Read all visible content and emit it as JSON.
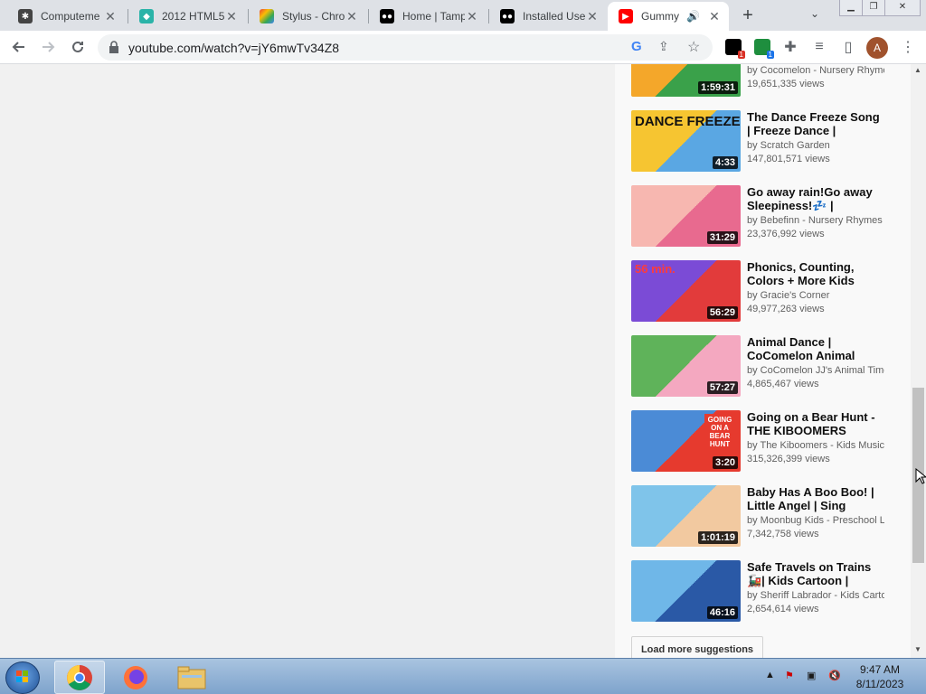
{
  "browser": {
    "tabs": [
      {
        "title": "Computeme",
        "icon": "bug-icon"
      },
      {
        "title": "2012 HTML5",
        "icon": "site-icon"
      },
      {
        "title": "Stylus - Chro",
        "icon": "chrome-webstore-icon"
      },
      {
        "title": "Home | Tamp",
        "icon": "tampermonkey-icon"
      },
      {
        "title": "Installed Use",
        "icon": "tampermonkey-icon"
      },
      {
        "title": "Gummy",
        "icon": "youtube-icon",
        "active": true
      }
    ],
    "new_tab_symbol": "+",
    "tab_list_symbol": "⌄",
    "url": "youtube.com/watch?v=jY6mwTv34Z8",
    "extension_badges": [
      "1",
      "1"
    ],
    "profile_initial": "A"
  },
  "colors": {
    "accent_youtube": "#ff0000",
    "duration_bg": "#000000",
    "sidebar_bg": "#f9f9f9"
  },
  "sidebar": {
    "videos": [
      {
        "title": "",
        "channel": "by Cocomelon - Nursery Rhymes",
        "views": "19,651,335 views",
        "duration": "1:59:31",
        "thumb_colors": [
          "#f4a72a",
          "#3aa14a"
        ]
      },
      {
        "title": "The Dance Freeze Song | Freeze Dance |",
        "channel": "by Scratch Garden",
        "views": "147,801,571 views",
        "duration": "4:33",
        "thumb_colors": [
          "#f6c531",
          "#5aa7e3"
        ],
        "thumb_text": "DANCE FREEZE"
      },
      {
        "title": "Go away rain!󠀠Go away Sleepiness!💤 |",
        "channel": "by Bebefinn - Nursery Rhymes",
        "views": "23,376,992 views",
        "duration": "31:29",
        "thumb_colors": [
          "#f7b7b0",
          "#e86a8f"
        ]
      },
      {
        "title": "Phonics, Counting, Colors + More Kids",
        "channel": "by Gracie's Corner",
        "views": "49,977,263 views",
        "duration": "56:29",
        "thumb_colors": [
          "#7b4bd6",
          "#e23b3b"
        ],
        "thumb_text": "56 min."
      },
      {
        "title": "Animal Dance | CoComelon Animal",
        "channel": "by CoComelon JJ's Animal Time",
        "views": "4,865,467 views",
        "duration": "57:27",
        "thumb_colors": [
          "#5fb35a",
          "#f4a8c0"
        ]
      },
      {
        "title": "Going on a Bear Hunt - THE KIBOOMERS",
        "channel": "by The Kiboomers - Kids Music",
        "views": "315,326,399 views",
        "duration": "3:20",
        "thumb_colors": [
          "#4b8bd6",
          "#e63a2e"
        ],
        "thumb_text": "GOING ON A BEAR HUNT"
      },
      {
        "title": "Baby Has A Boo Boo! | Little Angel | Sing",
        "channel": "by Moonbug Kids - Preschool L",
        "views": "7,342,758 views",
        "duration": "1:01:19",
        "thumb_colors": [
          "#7fc4ea",
          "#f2c9a0"
        ]
      },
      {
        "title": "Safe Travels on Trains 🚂| Kids Cartoon |",
        "channel": "by Sheriff Labrador - Kids Carto",
        "views": "2,654,614 views",
        "duration": "46:16",
        "thumb_colors": [
          "#6fb7e8",
          "#2a59a6"
        ]
      }
    ],
    "load_more": "Load more suggestions"
  },
  "taskbar": {
    "apps": [
      "chrome-icon",
      "firefox-icon",
      "file-explorer-icon"
    ],
    "time": "9:47 AM",
    "date": "8/11/2023"
  }
}
